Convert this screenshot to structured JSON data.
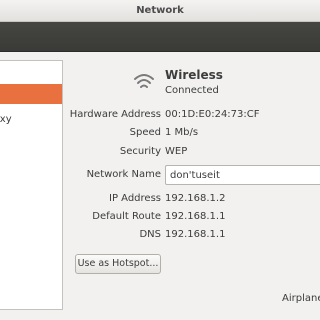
{
  "window": {
    "title": "Network"
  },
  "sidebar": {
    "items": [
      {
        "label": "",
        "selected": true
      },
      {
        "label": "oxy",
        "selected": false
      }
    ]
  },
  "device": {
    "icon": "wifi-icon",
    "name": "Wireless",
    "status": "Connected"
  },
  "details": {
    "hardware_address": {
      "label": "Hardware Address",
      "value": "00:1D:E0:24:73:CF"
    },
    "speed": {
      "label": "Speed",
      "value": "1 Mb/s"
    },
    "security": {
      "label": "Security",
      "value": "WEP"
    },
    "network_name": {
      "label": "Network Name",
      "value": "don'tuseit"
    },
    "ip_address": {
      "label": "IP Address",
      "value": "192.168.1.2"
    },
    "default_route": {
      "label": "Default Route",
      "value": "192.168.1.1"
    },
    "dns": {
      "label": "DNS",
      "value": "192.168.1.1"
    }
  },
  "buttons": {
    "hotspot": "Use as Hotspot..."
  },
  "footer": {
    "airplane_label": "Airplane"
  },
  "colors": {
    "accent": "#e9703f",
    "toolbar": "#3e3e3b"
  }
}
